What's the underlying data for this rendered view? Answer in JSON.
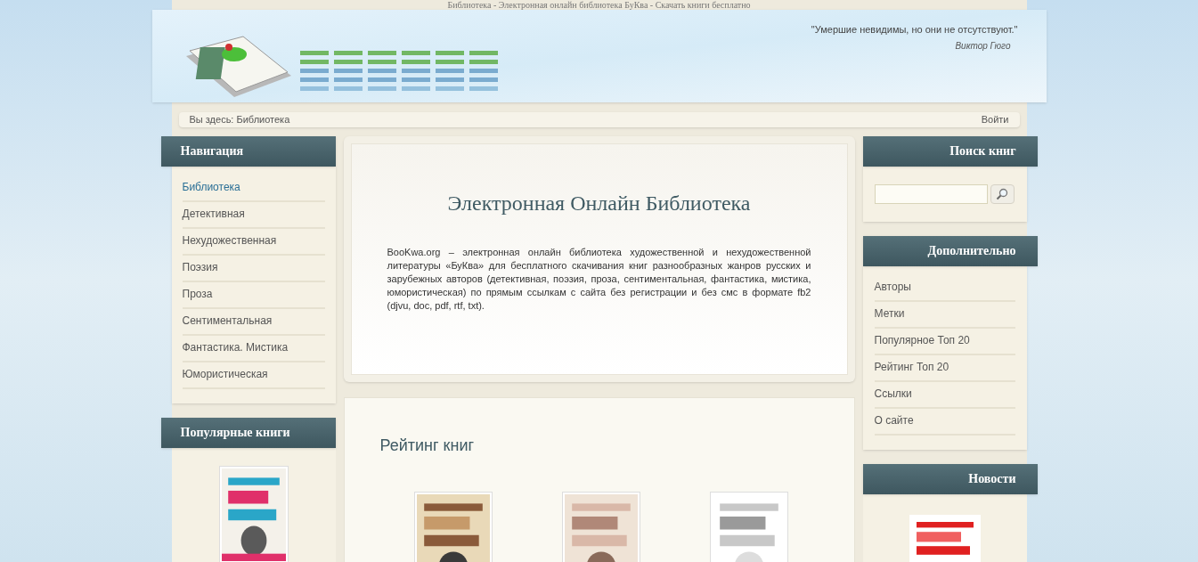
{
  "page_title": "Библиотека - Электронная онлайн библиотека БуКва - Скачать книги бесплатно",
  "header": {
    "quote": "\"Умершие невидимы, но они не отсутствуют.\"",
    "quote_author": "Виктор Гюго"
  },
  "breadcrumb": "Вы здесь: Библиотека",
  "login": "Войти",
  "navigation": {
    "title": "Навигация",
    "items": [
      {
        "label": "Библиотека",
        "selected": true
      },
      {
        "label": "Детективная",
        "selected": false
      },
      {
        "label": "Нехудожественная",
        "selected": false
      },
      {
        "label": "Поэзия",
        "selected": false
      },
      {
        "label": "Проза",
        "selected": false
      },
      {
        "label": "Сентиментальная",
        "selected": false
      },
      {
        "label": "Фантастика. Мистика",
        "selected": false
      },
      {
        "label": "Юмористическая",
        "selected": false
      }
    ]
  },
  "popular_books": {
    "title": "Популярные книги"
  },
  "intro": {
    "title": "Электронная Онлайн Библиотека",
    "text": "BooKwa.org – электронная онлайн библиотека художественной и нехудожественной литературы «БуКва» для бесплатного скачивания книг разнообразных жанров русских и зарубежных авторов (детективная, поэзия, проза, сентиментальная, фантастика, мистика, юмористическая) по прямым ссылкам с сайта без регистрации и без смс в формате fb2 (djvu, doc, pdf, rtf, txt)."
  },
  "rating": {
    "title": "Рейтинг книг"
  },
  "search": {
    "title": "Поиск книг"
  },
  "extra": {
    "title": "Дополнительно",
    "items": [
      {
        "label": "Авторы"
      },
      {
        "label": "Метки"
      },
      {
        "label": "Популярное Топ 20"
      },
      {
        "label": "Рейтинг Топ 20"
      },
      {
        "label": "Ссылки"
      },
      {
        "label": "О сайте"
      }
    ]
  },
  "news": {
    "title": "Новости"
  }
}
